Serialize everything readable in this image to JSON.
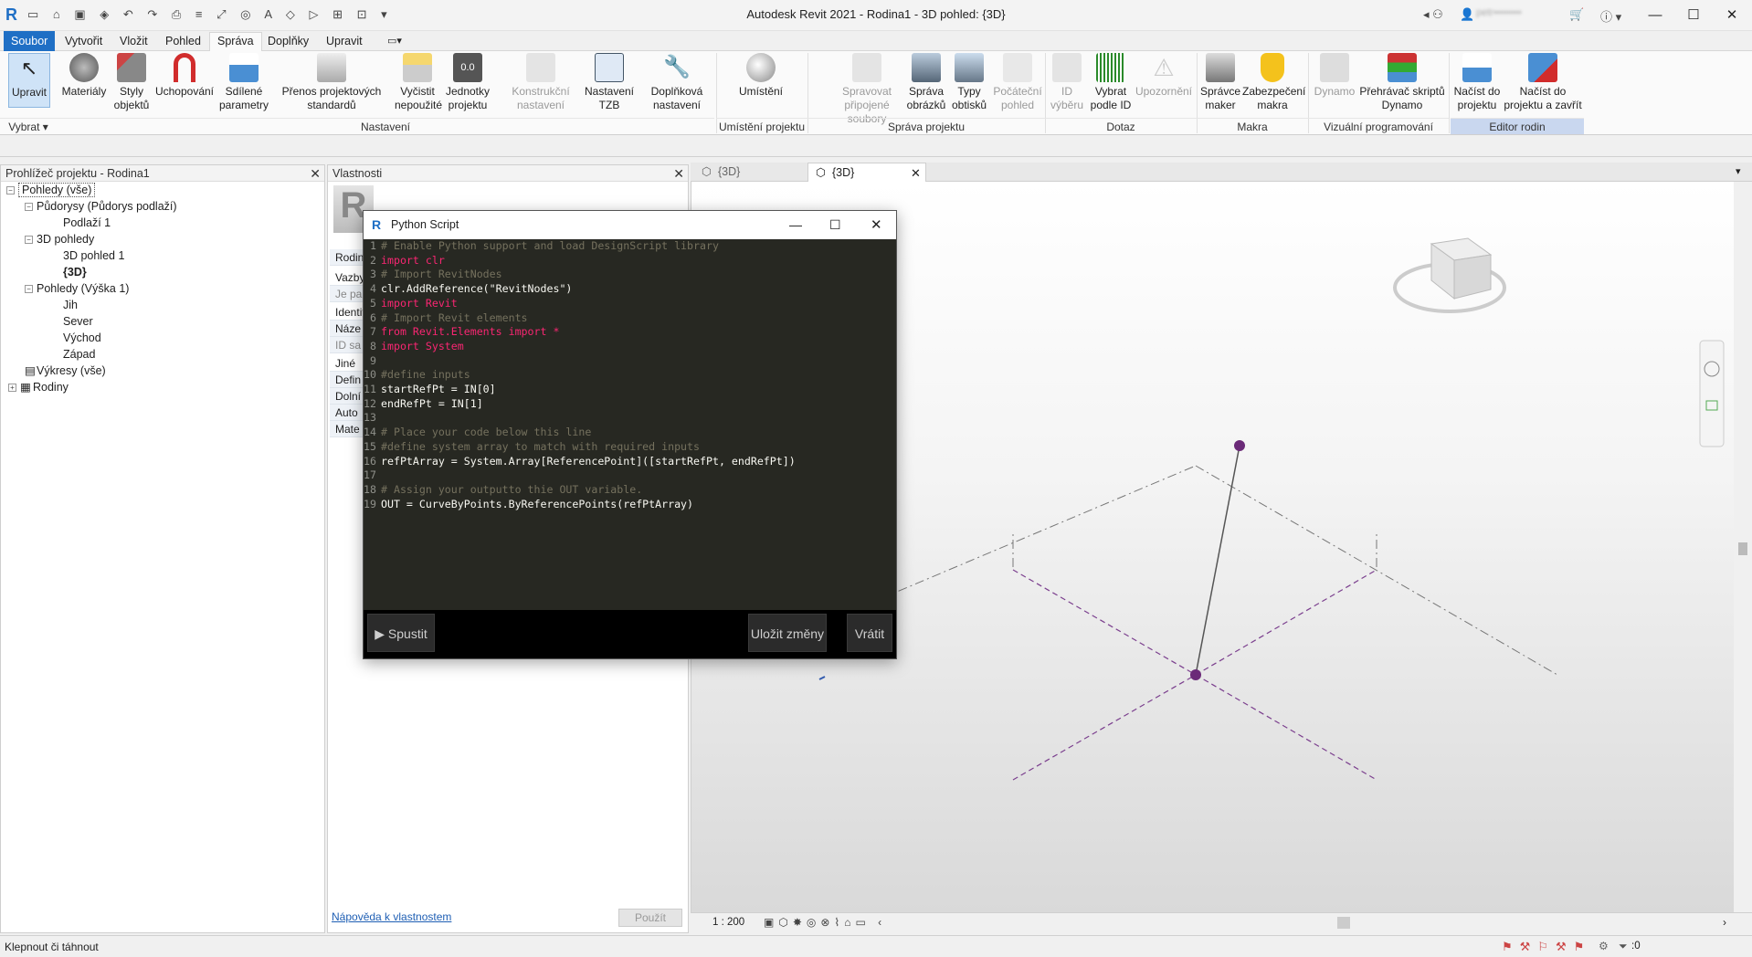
{
  "window": {
    "title": "Autodesk Revit 2021 - Rodina1 - 3D pohled: {3D}",
    "user": "petr••••••••"
  },
  "tabs": [
    "Soubor",
    "Vytvořit",
    "Vložit",
    "Pohled",
    "Správa",
    "Doplňky",
    "Upravit"
  ],
  "ribbon": {
    "buttons": [
      "Upravit",
      "Materiály",
      "Styly objektů",
      "Uchopování",
      "Sdílené parametry",
      "Přenos projektových standardů",
      "Vyčistit nepoužité",
      "Jednotky projektu",
      "Konstrukční nastavení",
      "Nastavení TZB",
      "Doplňková nastavení",
      "Umístění",
      "Spravovat připojené soubory",
      "Správa obrázků",
      "Typy obtisků",
      "Počáteční pohled",
      "ID výběru",
      "Vybrat podle ID",
      "Upozornění",
      "Správce maker",
      "Zabezpečení makra",
      "Dynamo",
      "Přehrávač skriptů Dynamo",
      "Načíst do projektu",
      "Načíst do projektu a zavřít"
    ],
    "groups": [
      "Vybrat",
      "Nastavení",
      "Umístění projektu",
      "Správa projektu",
      "Dotaz",
      "Makra",
      "Vizuální programování",
      "Editor rodin"
    ]
  },
  "project_browser": {
    "title": "Prohlížeč projektu - Rodina1",
    "items": [
      "Pohledy (vše)",
      "Půdorysy (Půdorys podlaží)",
      "Podlaží 1",
      "3D pohledy",
      "3D pohled 1",
      "{3D}",
      "Pohledy (Výška 1)",
      "Jih",
      "Sever",
      "Východ",
      "Západ",
      "Výkresy (vše)",
      "Rodiny"
    ]
  },
  "properties": {
    "title": "Vlastnosti",
    "rows": [
      "Rodin",
      "Vazby",
      "Je pa",
      "Identif",
      "Náze",
      "ID sa",
      "Jiné",
      "Defin",
      "Dolní",
      "Auto",
      "Mate"
    ],
    "help_link": "Nápověda k vlastnostem",
    "apply": "Použít"
  },
  "view_tabs": [
    "{3D}",
    "{3D}"
  ],
  "viewbar": {
    "scale": "1 : 200"
  },
  "status": {
    "text": "Klepnout či táhnout",
    "filter": ":0"
  },
  "python": {
    "title": "Python Script",
    "run": "Spustit",
    "save": "Uložit změny",
    "revert": "Vrátit",
    "lines": [
      "# Enable Python support and load DesignScript library",
      "import clr",
      "# Import RevitNodes",
      "clr.AddReference(\"RevitNodes\")",
      "import Revit",
      "# Import Revit elements",
      "from Revit.Elements import *",
      "import System",
      "",
      "#define inputs",
      "startRefPt = IN[0]",
      "endRefPt = IN[1]",
      "",
      "# Place your code below this line",
      "#define system array to match with required inputs",
      "refPtArray = System.Array[ReferencePoint]([startRefPt, endRefPt])",
      "",
      "# Assign your outputto thie OUT variable.",
      "OUT = CurveByPoints.ByReferencePoints(refPtArray)"
    ]
  },
  "colors": {
    "accent": "#1f6fc5",
    "refpoint": "#6b2a78",
    "code_bg": "#272822"
  }
}
